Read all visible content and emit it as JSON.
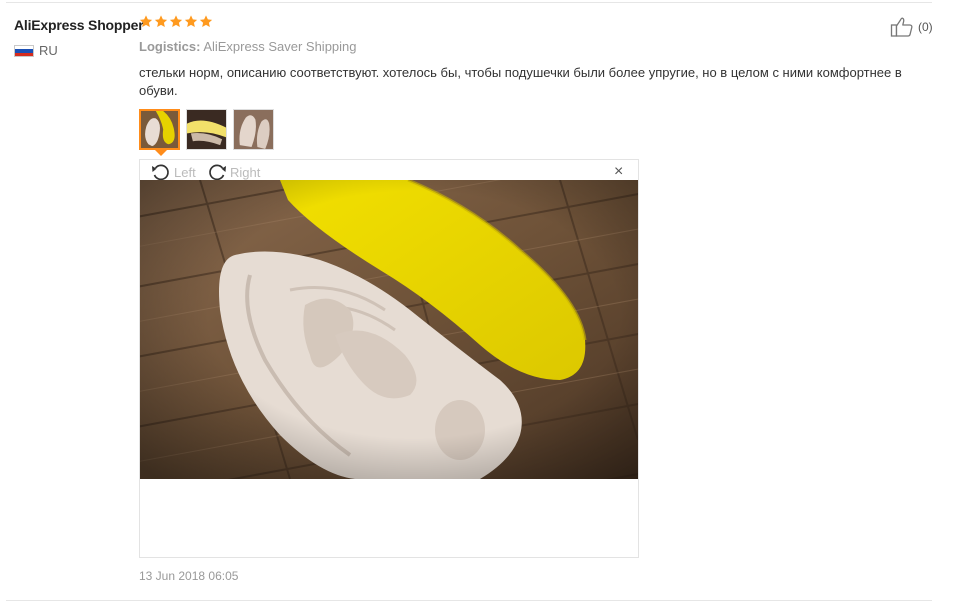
{
  "review": {
    "user_name": "AliExpress Shopper",
    "country": "RU",
    "rating": 5,
    "logistics_label": "Logistics:",
    "logistics_value": "AliExpress Saver Shipping",
    "text": "стельки норм, описанию соответствуют. хотелось бы, чтобы подушечки были более упругие, но в целом с ними комфортнее в обуви.",
    "helpful_count": "(0)",
    "date": "13 Jun 2018 06:05"
  },
  "viewer": {
    "rotate_left_label": "Left",
    "rotate_right_label": "Right",
    "close_symbol": "×"
  },
  "thumbnails": [
    {
      "name": "photo-1",
      "active": true
    },
    {
      "name": "photo-2",
      "active": false
    },
    {
      "name": "photo-3",
      "active": false
    }
  ],
  "colors": {
    "star": "#ff9a1f",
    "active_border": "#ff8c1a",
    "muted_text": "#999999"
  },
  "icons": [
    "star-icon",
    "thumbs-up-icon",
    "rotate-left-icon",
    "rotate-right-icon",
    "close-icon",
    "russia-flag-icon"
  ]
}
